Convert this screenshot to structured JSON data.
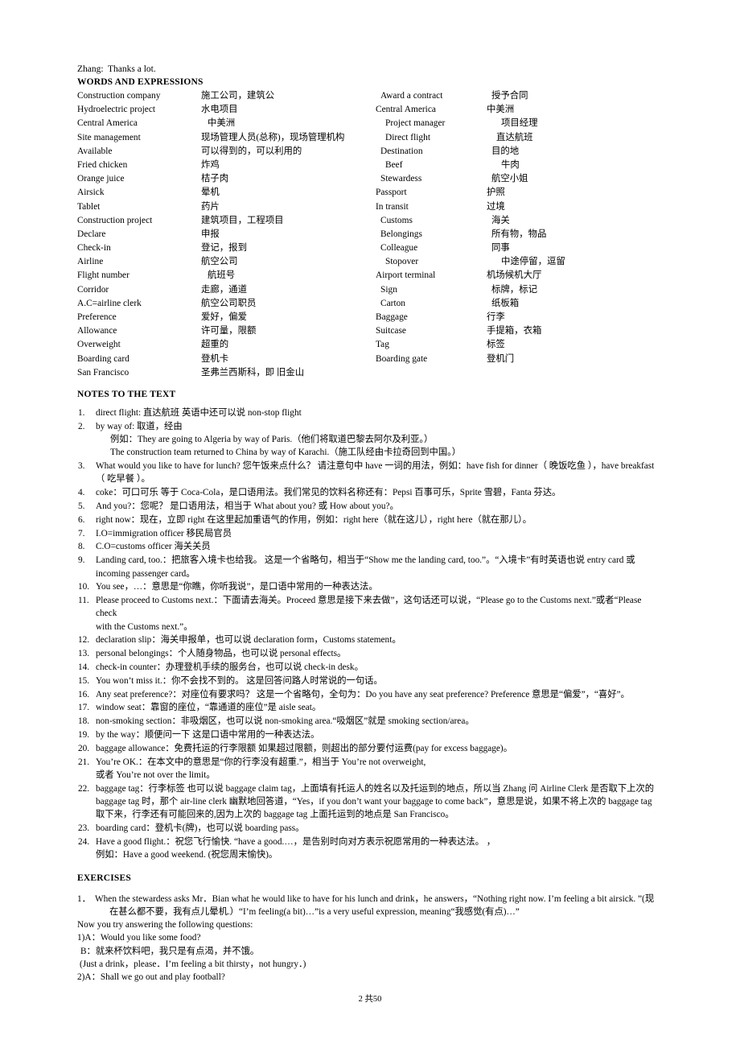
{
  "document": {
    "dialogue_line": {
      "speaker": "Zhang:",
      "text": "Thanks a lot."
    },
    "words_heading": "WORDS AND EXPRESSIONS",
    "vocab_left": [
      {
        "en": "Construction company",
        "cn": "施工公司，建筑公"
      },
      {
        "en": "Hydroelectric project",
        "cn": "水电项目"
      },
      {
        "en": "Central America",
        "cn": "中美洲"
      },
      {
        "en": "Site management",
        "cn": "现场管理人员(总称)，现场管理机构"
      },
      {
        "en": "Available",
        "cn": "可以得到的，可以利用的"
      },
      {
        "en": "Fried chicken",
        "cn": "炸鸡"
      },
      {
        "en": "Orange juice",
        "cn": "桔子肉"
      },
      {
        "en": "Airsick",
        "cn": "晕机"
      },
      {
        "en": "Tablet",
        "cn": "药片"
      },
      {
        "en": "Construction project",
        "cn": "建筑项目，工程项目"
      },
      {
        "en": "Declare",
        "cn": "申报"
      },
      {
        "en": "Check-in",
        "cn": "登记，报到"
      },
      {
        "en": "Airline",
        "cn": "航空公司"
      },
      {
        "en": "Flight number",
        "cn": "航班号"
      },
      {
        "en": "Corridor",
        "cn": "走廊，通道"
      },
      {
        "en": "A.C=airline clerk",
        "cn": "航空公司职员"
      },
      {
        "en": "Preference",
        "cn": "爱好，偏爱"
      },
      {
        "en": "Allowance",
        "cn": "许可量，限额"
      },
      {
        "en": "Overweight",
        "cn": "超重的"
      },
      {
        "en": "Boarding card",
        "cn": "登机卡"
      },
      {
        "en": "San Francisco",
        "cn": "圣弗兰西斯科，即 旧金山"
      }
    ],
    "vocab_right": [
      {
        "en": "Award a contract",
        "cn": "授予合同"
      },
      {
        "en": "Central America",
        "cn": "中美洲"
      },
      {
        "en": "Project manager",
        "cn": "项目经理"
      },
      {
        "en": "Direct flight",
        "cn": "直达航班"
      },
      {
        "en": "Destination",
        "cn": "目的地"
      },
      {
        "en": "Beef",
        "cn": "牛肉"
      },
      {
        "en": "Stewardess",
        "cn": "航空小姐"
      },
      {
        "en": "Passport",
        "cn": "护照"
      },
      {
        "en": "In transit",
        "cn": "过境"
      },
      {
        "en": "Customs",
        "cn": "海关"
      },
      {
        "en": "Belongings",
        "cn": "所有物，物品"
      },
      {
        "en": "Colleague",
        "cn": "同事"
      },
      {
        "en": "Stopover",
        "cn": "中途停留，逗留"
      },
      {
        "en": "Airport terminal",
        "cn": "机场候机大厅"
      },
      {
        "en": "Sign",
        "cn": "标牌，标记"
      },
      {
        "en": "Carton",
        "cn": "纸板箱"
      },
      {
        "en": "Baggage",
        "cn": "行李"
      },
      {
        "en": "Suitcase",
        "cn": "手提箱，衣箱"
      },
      {
        "en": "Tag",
        "cn": "标签"
      },
      {
        "en": "Boarding gate",
        "cn": "登机门"
      }
    ],
    "notes_heading": "NOTES TO THE TEXT",
    "notes": [
      {
        "num": "1.",
        "body": "direct flight: 直达航班  英语中还可以说 non-stop flight"
      },
      {
        "num": "2.",
        "body": "by way of: 取道，经由",
        "sub1": "例如：They are going to Algeria by way of Paris.（他们将取道巴黎去阿尔及利亚。）",
        "sub2": "The construction team returned to China by way of Karachi.（施工队经由卡拉奇回到中国。）"
      },
      {
        "num": "3.",
        "body": "What would you like to have for lunch? 您午饭来点什么？  请注意句中 have 一词的用法，例如：have fish for dinner（ 晚饭吃鱼 ），have breakfast",
        "cont": "（ 吃早餐 ）。"
      },
      {
        "num": "4.",
        "body": "coke：可口可乐 等于 Coca-Cola，是口语用法。我们常见的饮料名称还有：Pepsi 百事可乐，Sprite 雪碧，Fanta 芬达。"
      },
      {
        "num": "5.",
        "body": "And you?：您呢？   是口语用法，相当于 What about you? 或 How about you?。"
      },
      {
        "num": "6.",
        "body": "right now：现在，立即  right 在这里起加重语气的作用，例如：right here（就在这儿），right here（就在那儿）。"
      },
      {
        "num": "7.",
        "body": "I.O=immigration officer  移民局官员"
      },
      {
        "num": "8.",
        "body": "C.O=customs officer  海关关员"
      },
      {
        "num": "9.",
        "body": "Landing card, too.：把旅客入境卡也给我。   这是一个省略句，相当于“Show me the landing card, too.”。“入境卡”有时英语也说  entry card  或",
        "cont": "incoming passenger card。"
      },
      {
        "num": "10.",
        "body": "You see，…：意思是“你瞧，你听我说”，是口语中常用的一种表达法。"
      },
      {
        "num": "11.",
        "body": "Please proceed to Customs next.：下面请去海关。Proceed 意思是接下来去做”，这句话还可以说，“Please go to the Customs next.”或者“Please check",
        "cont": "with the Customs next.”。"
      },
      {
        "num": "12.",
        "body": "declaration slip：海关申报单，也可以说 declaration form，Customs statement。"
      },
      {
        "num": "13.",
        "body": "personal belongings：个人随身物品，也可以说 personal effects。"
      },
      {
        "num": "14.",
        "body": "check-in counter：办理登机手续的服务台，也可以说 check-in desk。"
      },
      {
        "num": "15.",
        "body": "You won’t miss it.：你不会找不到的。   这是回答问路人时常说的一句话。"
      },
      {
        "num": "16.",
        "body": "Any seat preference?：对座位有要求吗？   这是一个省略句，全句为：Do you have any seat preference? Preference  意思是“偏爱”，“喜好”。"
      },
      {
        "num": "17.",
        "body": "window seat：靠窗的座位，“靠通道的座位”是 aisle seat。"
      },
      {
        "num": "18.",
        "body": "non-smoking section：非吸烟区，也可以说 non-smoking area.“吸烟区”就是 smoking section/area。"
      },
      {
        "num": "19.",
        "body": "by the way：顺便问一下   这是口语中常用的一种表达法。"
      },
      {
        "num": "20.",
        "body": "baggage allowance：免费托运的行李限额   如果超过限额，则超出的部分要付运费(pay for excess baggage)。"
      },
      {
        "num": "21.",
        "body": "You’re OK.：在本文中的意思是“你的行李没有超重.”，相当于 You’re not overweight,",
        "cont": "或者 You’re not over the limit。"
      },
      {
        "num": "22.",
        "body": "baggage tag：行李标签 也可以说 baggage claim tag，上面填有托运人的姓名以及托运到的地点，所以当 Zhang 问 Airline Clerk 是否取下上次的",
        "cont": "baggage tag 时，那个 air-line clerk 幽默地回答道，“Yes，if you don’t want your baggage to come back”，意思是说，如果不将上次的 baggage tag",
        "cont2": "取下来，行李还有可能回来的,因为上次的 baggage tag 上面托运到的地点是 San Francisco。"
      },
      {
        "num": "23.",
        "body": "boarding card：登机卡(牌)，也可以说 boarding pass。"
      },
      {
        "num": "24.",
        "body": "Have a good flight.：祝您飞行愉快.      “have a good.…，是告别时向对方表示祝愿常用的一种表达法。        ，",
        "cont": "例如：Have a good weekend.  (祝您周末愉快)。"
      }
    ],
    "exercises_heading": "EXERCISES",
    "exercise1": {
      "num": "1．",
      "body": "When the stewardess asks Mr．Bian what he would like to have for his lunch and drink，he answers，“Nothing right now. I’m feeling a bit airsick. ”(现",
      "cont": "在甚么都不要，我有点儿晕机.）“I’m feeling(a bit)…”is a very useful expression, meaning“我感觉(有点)…”"
    },
    "exercise_lines": [
      "Now you try answering the following questions:",
      "1)A：Would you like some food?",
      "B：就来杯饮料吧，我只是有点渴，并不饿。",
      "(Just a drink，please．I’m feeling a bit thirsty，not hungry．)",
      "2)A：Shall we go out and play football?"
    ],
    "footer": "2 共50"
  }
}
